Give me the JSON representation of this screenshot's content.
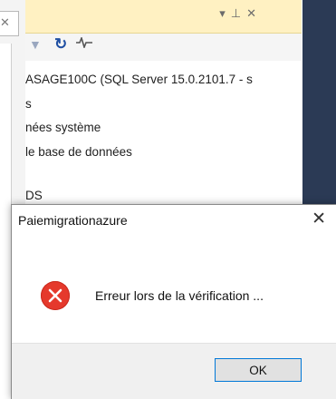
{
  "background_window": {
    "pane_controls": [
      "▾",
      "⊥",
      "✕"
    ],
    "toolbar": {
      "refresh_icon": "refresh-icon",
      "activity_icon": "activity-icon"
    },
    "tree_lines": [
      "ASAGE100C (SQL Server 15.0.2101.7 - s",
      "s",
      "nées système",
      "le base de données",
      "",
      "DS"
    ],
    "colors": {
      "header": "#fff1c2",
      "dark_panel": "#2b3a55"
    }
  },
  "dialog": {
    "title": "Paiemigrationazure",
    "close_symbol": "✕",
    "icon": "error-icon",
    "message": "Erreur lors de la vérification ...",
    "ok_label": "OK",
    "colors": {
      "error": "#e5392c",
      "focus_border": "#0078d7"
    }
  },
  "left_window": {
    "close_symbol": "✕"
  }
}
